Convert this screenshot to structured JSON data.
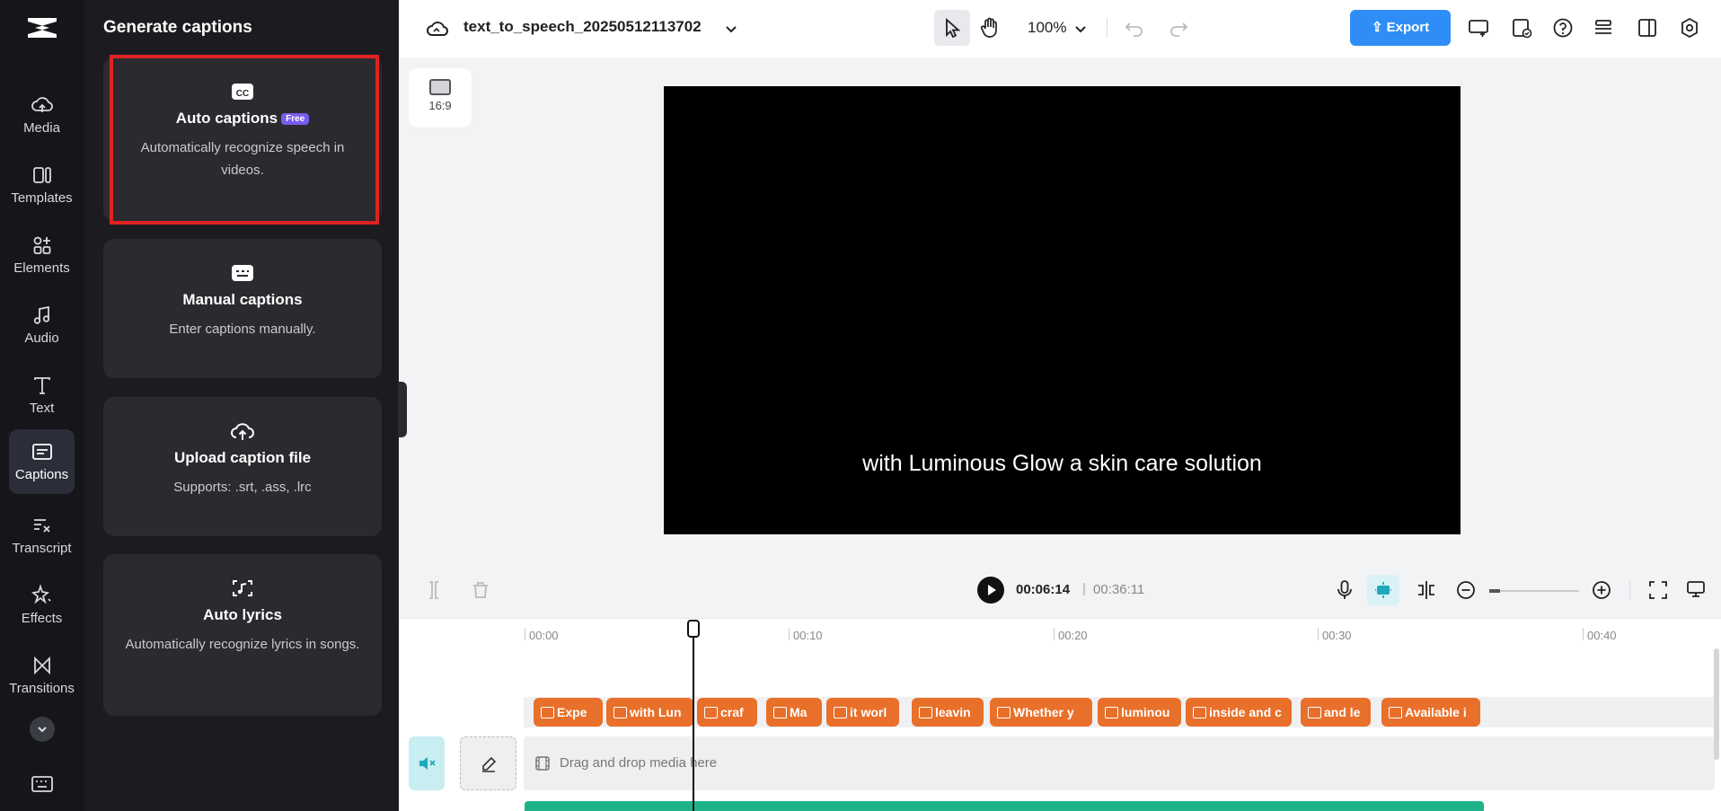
{
  "rail": {
    "items": [
      {
        "label": "Media",
        "icon": "cloud-upload-icon"
      },
      {
        "label": "Templates",
        "icon": "templates-icon"
      },
      {
        "label": "Elements",
        "icon": "elements-icon"
      },
      {
        "label": "Audio",
        "icon": "music-note-icon"
      },
      {
        "label": "Text",
        "icon": "text-icon"
      },
      {
        "label": "Captions",
        "icon": "captions-icon",
        "active": true
      },
      {
        "label": "Transcript",
        "icon": "transcript-icon"
      },
      {
        "label": "Effects",
        "icon": "effects-icon"
      },
      {
        "label": "Transitions",
        "icon": "transitions-icon"
      }
    ]
  },
  "panel": {
    "title": "Generate captions",
    "cards": [
      {
        "title": "Auto captions",
        "badge": "Free",
        "desc": "Automatically recognize speech in videos.",
        "icon": "cc-icon"
      },
      {
        "title": "Manual captions",
        "desc": "Enter captions manually.",
        "icon": "keyboard-icon"
      },
      {
        "title": "Upload caption file",
        "desc": "Supports: .srt, .ass, .lrc",
        "icon": "cloud-upload-icon"
      },
      {
        "title": "Auto lyrics",
        "desc": "Automatically recognize lyrics in songs.",
        "icon": "lyrics-icon"
      }
    ]
  },
  "topbar": {
    "project_name": "text_to_speech_20250512113702",
    "zoom": "100%",
    "export_label": "Export"
  },
  "preview": {
    "aspect_ratio": "16:9",
    "subtitle": "with Luminous Glow a skin care solution"
  },
  "timeline": {
    "current_time": "00:06:14",
    "separator": "|",
    "total_time": "00:36:11",
    "ticks": [
      "00:00",
      "00:10",
      "00:20",
      "00:30",
      "00:40"
    ],
    "drop_text": "Drag and drop media here",
    "captions": [
      "Expe",
      "with Lun",
      "craf",
      "Ma",
      "it worl",
      "leavin",
      "Whether y",
      "luminou",
      "inside and c",
      "and le",
      "Available i"
    ]
  },
  "colors": {
    "accent": "#2e8ef5",
    "caption_chip": "#e8702a",
    "audio_track": "#1fb28a",
    "highlight": "#e02222"
  }
}
